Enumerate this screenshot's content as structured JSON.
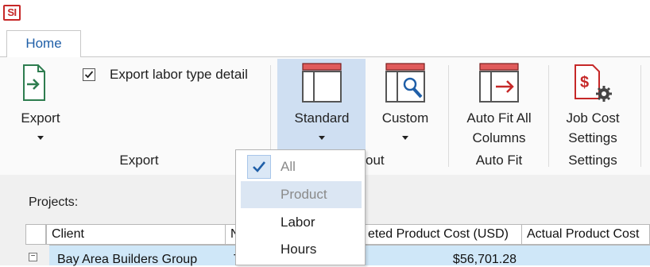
{
  "app": {
    "logo_text": "SI"
  },
  "tabs": [
    {
      "label": "Home"
    }
  ],
  "ribbon": {
    "export_button": {
      "label": "Export"
    },
    "export_labor_checkbox": {
      "label": "Export labor type detail",
      "checked": true
    },
    "standard_button": {
      "label": "Standard"
    },
    "custom_button": {
      "label": "Custom"
    },
    "autofit_button": {
      "label_line1": "Auto Fit All",
      "label_line2": "Columns"
    },
    "jobcost_button": {
      "label_line1": "Job Cost",
      "label_line2": "Settings"
    },
    "groups": {
      "export": "Export",
      "layout_partial": "out",
      "autofit": "Auto Fit",
      "settings": "Settings"
    }
  },
  "projects": {
    "label": "Projects:",
    "columns": [
      "Client",
      "Na",
      "eted Product Cost (USD)",
      "Actual Product Cost"
    ],
    "rows": [
      {
        "client": "Bay Area Builders Group",
        "name_partial": "T",
        "cost": "$56,701.28",
        "expander": "−"
      }
    ]
  },
  "dropdown": {
    "items": [
      {
        "label": "All",
        "checked": true
      },
      {
        "label": "Product",
        "checked": false
      },
      {
        "label": "Labor",
        "checked": false
      },
      {
        "label": "Hours",
        "checked": false
      }
    ]
  },
  "colors": {
    "accent_red": "#c62828",
    "tab_blue": "#1f5fa8",
    "highlight": "#cfdff2",
    "row_select": "#cfe7f8"
  }
}
